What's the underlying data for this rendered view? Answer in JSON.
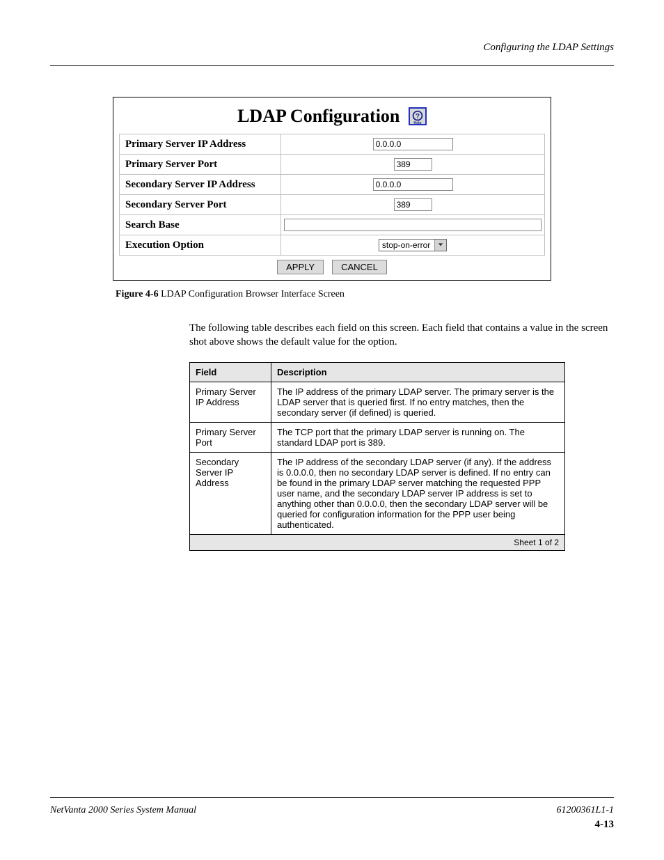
{
  "header": {
    "right": "Configuring the LDAP Settings"
  },
  "config": {
    "title": "LDAP Configuration",
    "help_icon_alt": "Help",
    "rows": {
      "primary_ip_label": "Primary Server IP Address",
      "primary_ip_value": "0.0.0.0",
      "primary_port_label": "Primary Server Port",
      "primary_port_value": "389",
      "secondary_ip_label": "Secondary Server IP Address",
      "secondary_ip_value": "0.0.0.0",
      "secondary_port_label": "Secondary Server Port",
      "secondary_port_value": "389",
      "search_base_label": "Search Base",
      "search_base_value": "",
      "exec_option_label": "Execution Option",
      "exec_option_value": "stop-on-error"
    },
    "buttons": {
      "apply": "APPLY",
      "cancel": "CANCEL"
    }
  },
  "figure": {
    "label": "Figure 4-6",
    "text": "LDAP Configuration Browser Interface Screen"
  },
  "paragraph": "The following table describes each field on this screen. Each field that contains a value in the screen shot above shows the default value for the option.",
  "def_table": {
    "headers": {
      "field": "Field",
      "desc": "Description"
    },
    "rows": [
      {
        "field": "Primary Server IP Address",
        "desc": "The IP address of the primary LDAP server. The primary server is the LDAP server that is queried first. If no entry matches, then the secondary server (if defined) is queried."
      },
      {
        "field": "Primary Server Port",
        "desc": "The TCP port that the primary LDAP server is running on. The standard LDAP port is 389."
      },
      {
        "field": "Secondary Server IP Address",
        "desc": "The IP address of the secondary LDAP server (if any). If the address is 0.0.0.0, then no secondary LDAP server is defined. If no entry can be found in the primary LDAP server matching the requested PPP user name, and the secondary LDAP server IP address is set to anything other than 0.0.0.0, then the secondary LDAP server will be queried for configuration information for the PPP user being authenticated."
      }
    ],
    "footer": "Sheet 1 of 2"
  },
  "footer": {
    "left": "NetVanta 2000 Series System Manual",
    "right_top": "61200361L1-1",
    "right_bottom": "4-13"
  }
}
